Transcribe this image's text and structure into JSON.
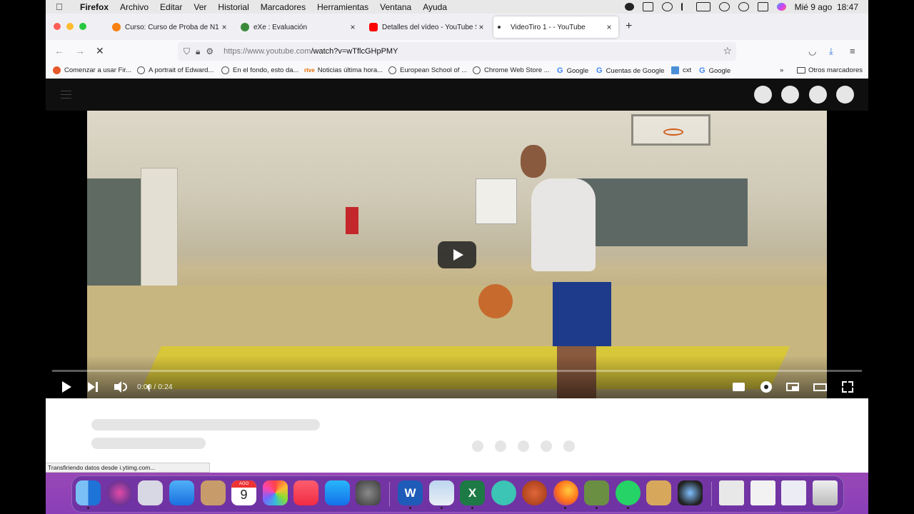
{
  "menubar": {
    "app_name": "Firefox",
    "items": [
      "Archivo",
      "Editar",
      "Ver",
      "Historial",
      "Marcadores",
      "Herramientas",
      "Ventana",
      "Ayuda"
    ],
    "datetime": "Mié 9 ago  18:47"
  },
  "tabs": [
    {
      "label": "Curso: Curso de Proba de N1",
      "icon": "moodle-icon",
      "active": false
    },
    {
      "label": "eXe : Evaluación",
      "icon": "exe-icon",
      "active": false
    },
    {
      "label": "Detalles del vídeo - YouTube Studio",
      "icon": "youtube-icon",
      "active": false
    },
    {
      "label": "VideoTiro 1 - - YouTube",
      "icon": "loading-dot-icon",
      "active": true
    }
  ],
  "navbar": {
    "url_host": "https://www.youtube.com",
    "url_path": "/watch?v=wTflcGHpPMY"
  },
  "bookmarks": [
    {
      "label": "Comenzar a usar Fir...",
      "icon": "firefox-icon"
    },
    {
      "label": "A portrait of Edward...",
      "icon": "globe-icon"
    },
    {
      "label": "En el fondo, esto da...",
      "icon": "globe-icon"
    },
    {
      "label": "Noticias última hora...",
      "icon": "rtve-icon",
      "prefix": "rtve"
    },
    {
      "label": "European School of ...",
      "icon": "globe-icon"
    },
    {
      "label": "Chrome Web Store ...",
      "icon": "globe-icon"
    },
    {
      "label": "Google",
      "icon": "google-icon"
    },
    {
      "label": "Cuentas de Google",
      "icon": "google-icon"
    },
    {
      "label": "cxt",
      "icon": "cxt-icon"
    },
    {
      "label": "Google",
      "icon": "google-icon"
    }
  ],
  "bookmarks_other": "Otros marcadores",
  "player": {
    "time": "0:00 / 0:24",
    "progress": 0.0
  },
  "status_text": "Transfiriendo datos desde i.ytimg.com...",
  "dock": {
    "calendar_month": "AGO",
    "calendar_day": "9",
    "apps": [
      "finder-icon",
      "siri-icon",
      "launchpad-icon",
      "mail-icon",
      "contacts-icon",
      "calendar-icon",
      "photos-icon",
      "music-icon",
      "app-store-icon",
      "system-preferences-icon",
      "word-icon",
      "preview-icon",
      "excel-icon",
      "lumi-icon",
      "basketball-app-icon",
      "firefox-icon",
      "exe-icon",
      "whatsapp-icon",
      "paint-icon",
      "quicktime-icon",
      "screenshot-1-icon",
      "screenshot-2-icon",
      "screenshot-3-icon",
      "trash-icon"
    ]
  }
}
